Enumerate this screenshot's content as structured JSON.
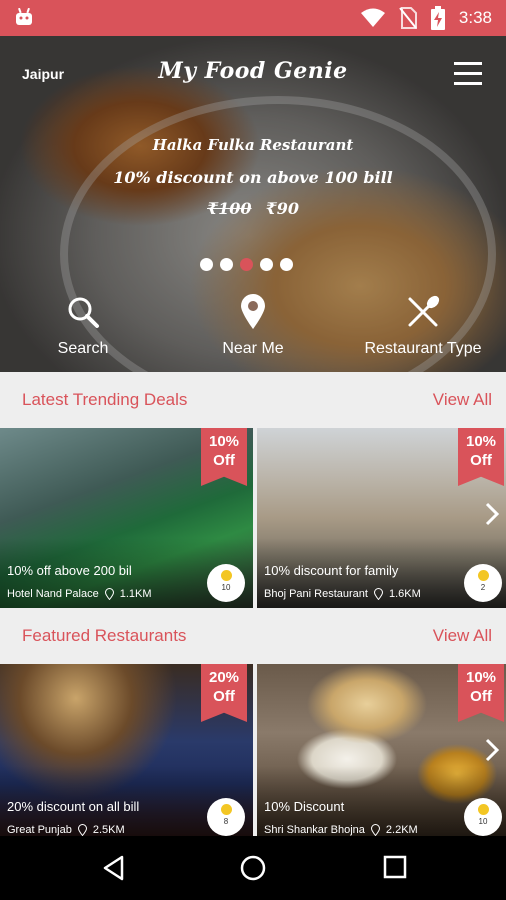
{
  "status_bar": {
    "time": "3:38",
    "icons": [
      "android-icon",
      "wifi-icon",
      "no-sim-icon",
      "battery-charging-icon"
    ]
  },
  "header": {
    "city": "Jaipur",
    "app_title": "My Food Genie",
    "menu_icon": "hamburger-menu-icon"
  },
  "banner": {
    "restaurant": "Halka Fulka Restaurant",
    "offer": "10% discount on above 100 bill",
    "old_price": "₹100",
    "new_price": "₹90",
    "slide_count": 5,
    "active_slide": 3
  },
  "quick_actions": [
    {
      "label": "Search",
      "icon": "search-icon"
    },
    {
      "label": "Near Me",
      "icon": "location-pin-icon"
    },
    {
      "label": "Restaurant Type",
      "icon": "fork-knife-icon"
    }
  ],
  "trending": {
    "title": "Latest Trending Deals",
    "view_all": "View All",
    "cards": [
      {
        "discount": "10%",
        "off": "Off",
        "deal": "10% off above 200 bil",
        "restaurant": "Hotel Nand Palace",
        "distance": "1.1KM",
        "rating": "10"
      },
      {
        "discount": "10%",
        "off": "Off",
        "deal": "10% discount for family",
        "restaurant": "Bhoj Pani Restaurant",
        "distance": "1.6KM",
        "rating": "2"
      }
    ]
  },
  "featured": {
    "title": "Featured Restaurants",
    "view_all": "View All",
    "cards": [
      {
        "discount": "20%",
        "off": "Off",
        "deal": "20% discount on all bill",
        "restaurant": "Great Punjab",
        "distance": "2.5KM",
        "rating": "8"
      },
      {
        "discount": "10%",
        "off": "Off",
        "deal": "10% Discount",
        "restaurant": "Shri Shankar Bhojna",
        "distance": "2.2KM",
        "rating": "10"
      }
    ]
  },
  "colors": {
    "accent": "#d9535a",
    "section_bg": "#eeeeee",
    "nav_bg": "#000000"
  },
  "nav_bar": [
    "back-icon",
    "home-icon",
    "recents-icon"
  ]
}
